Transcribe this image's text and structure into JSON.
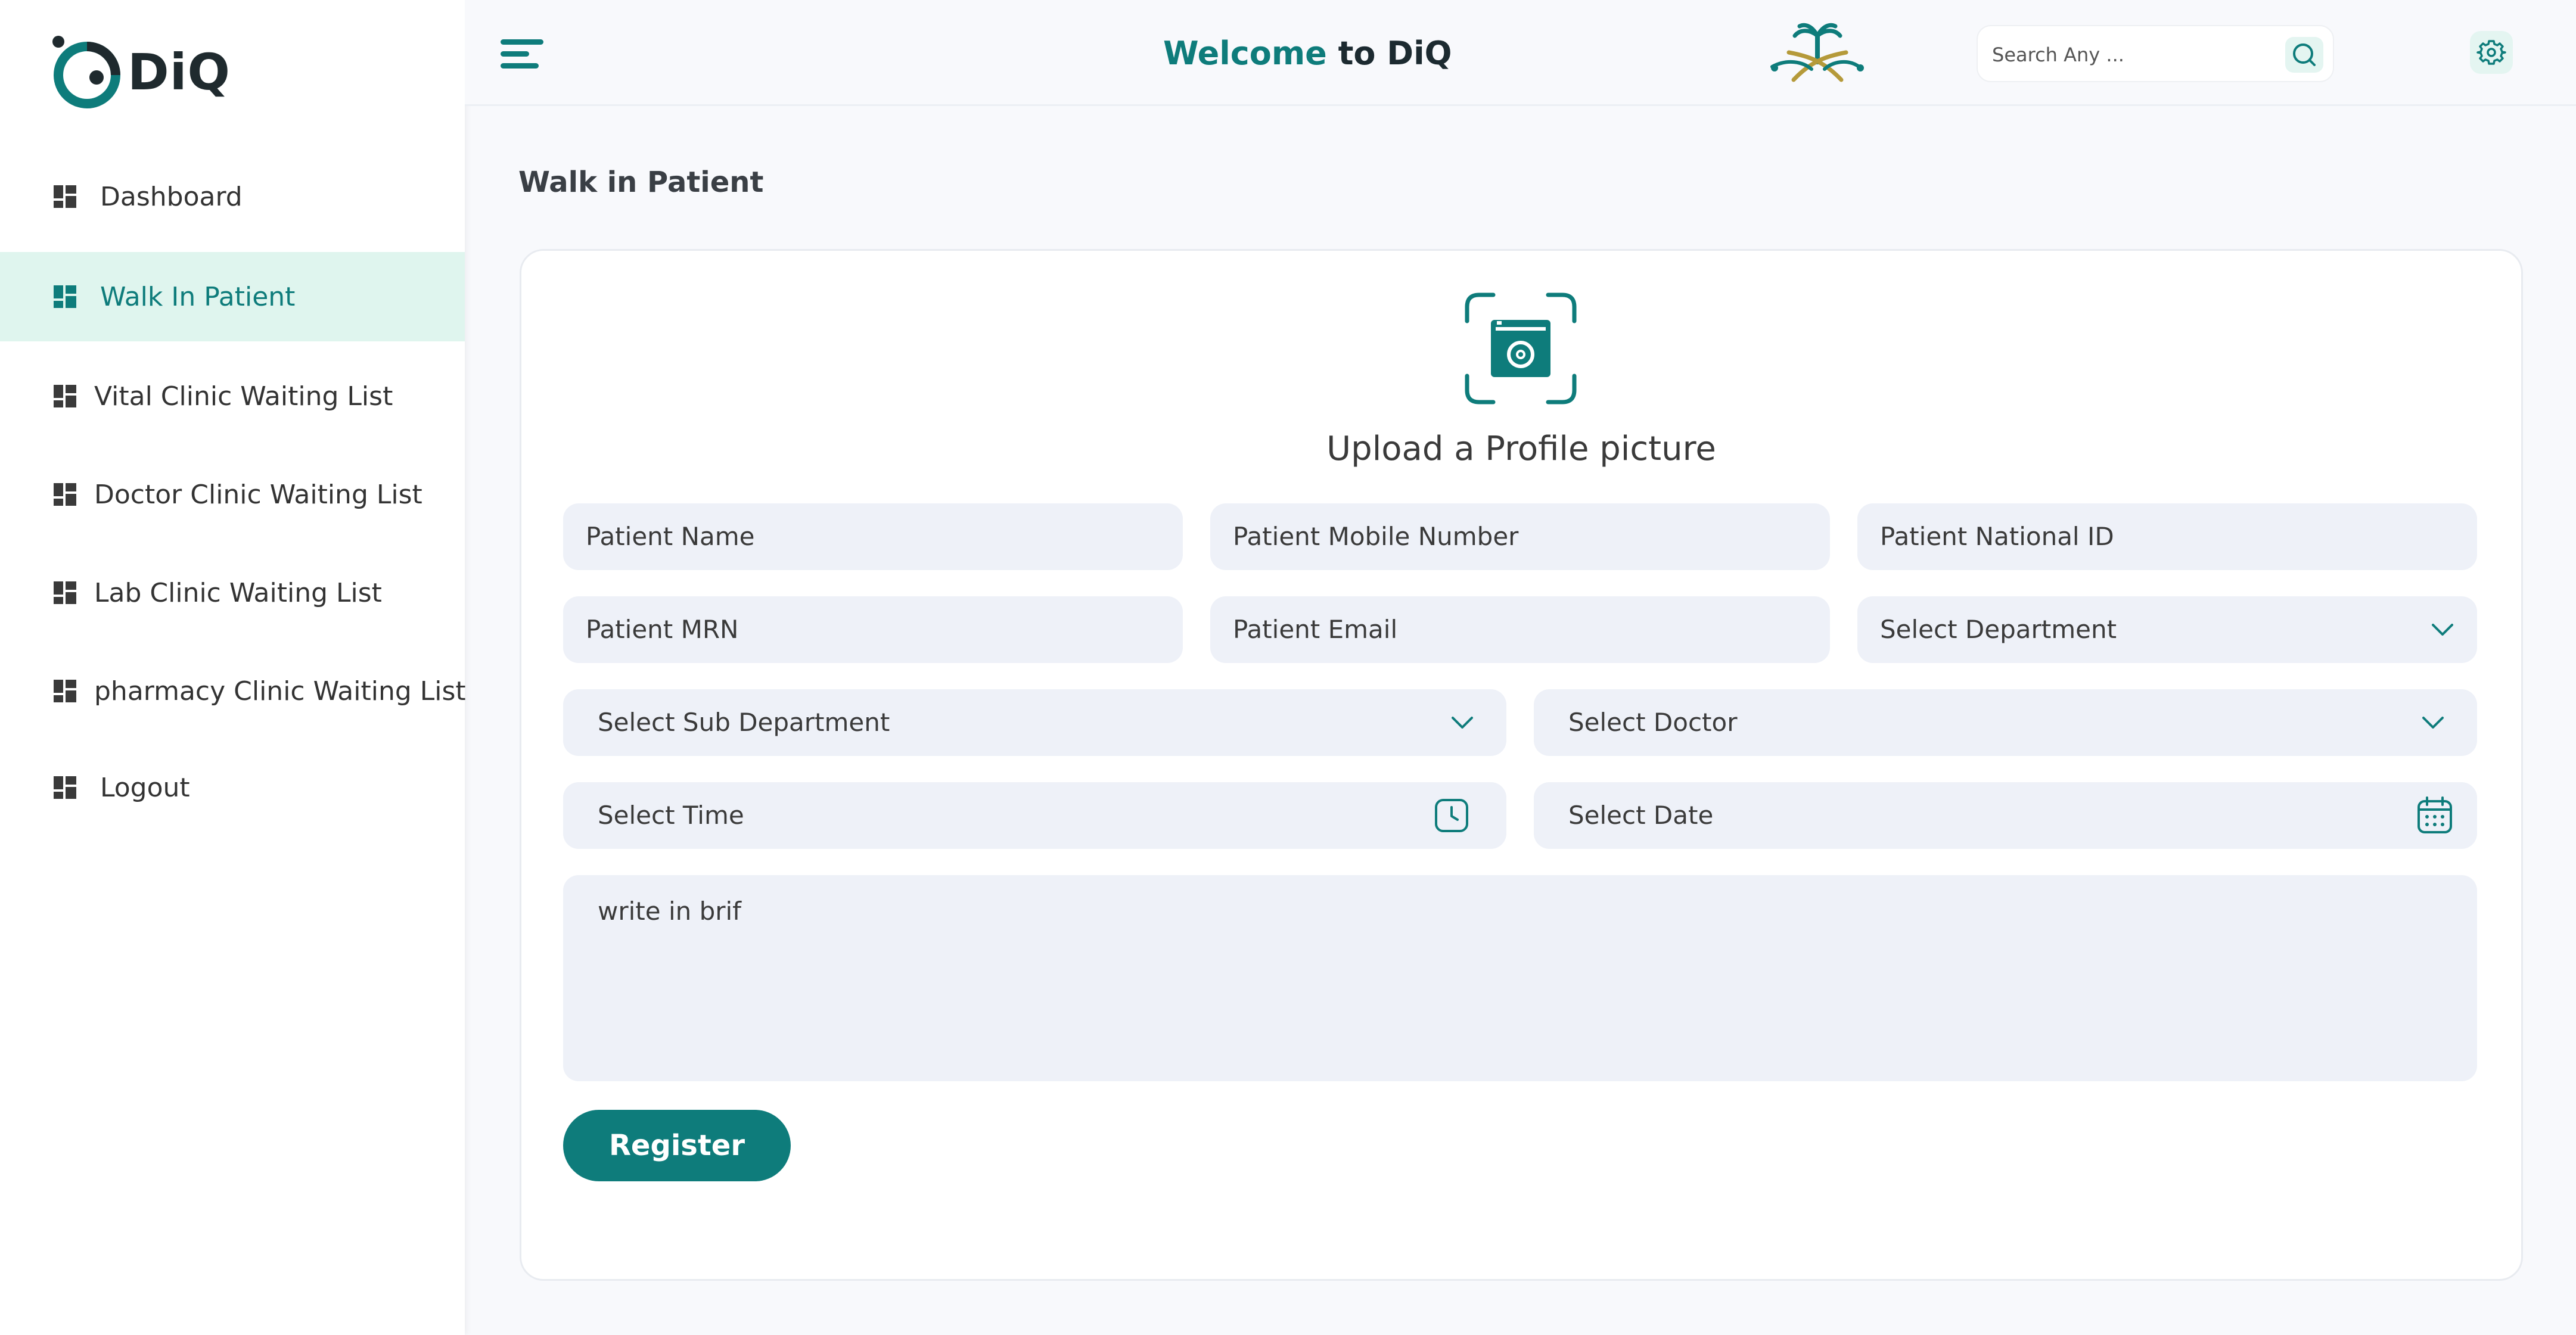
{
  "app": {
    "brand": "DiQ",
    "accent_color": "#0e7c7b",
    "active_bg_color": "#dff5ee"
  },
  "sidebar": {
    "items": [
      {
        "label": "Dashboard",
        "icon": "grid-icon"
      },
      {
        "label": "Walk In Patient",
        "icon": "grid-icon",
        "active": true
      },
      {
        "label": "Vital Clinic Waiting List",
        "icon": "grid-icon"
      },
      {
        "label": "Doctor Clinic Waiting List",
        "icon": "grid-icon"
      },
      {
        "label": "Lab Clinic Waiting List",
        "icon": "grid-icon"
      },
      {
        "label": "pharmacy Clinic Waiting List",
        "icon": "grid-icon"
      },
      {
        "label": "Logout",
        "icon": "grid-icon"
      }
    ]
  },
  "header": {
    "welcome_prefix": "Welcome",
    "welcome_suffix": "to DiQ",
    "search_placeholder": "Search Any ...",
    "icons": [
      "menu-icon",
      "search-icon",
      "emblem-icon",
      "gear-icon"
    ]
  },
  "main": {
    "page_title": "Walk in Patient",
    "upload_label": "Upload a Profile picture",
    "fields": {
      "patient_name": "Patient Name",
      "patient_mobile": "Patient Mobile Number",
      "patient_national_id": "Patient National ID",
      "patient_mrn": "Patient MRN",
      "patient_email": "Patient Email",
      "select_department": "Select Department",
      "select_sub_department": "Select Sub Department",
      "select_doctor": "Select Doctor",
      "select_time": "Select Time",
      "select_date": "Select Date",
      "brief": "write in brif"
    },
    "register_label": "Register"
  }
}
